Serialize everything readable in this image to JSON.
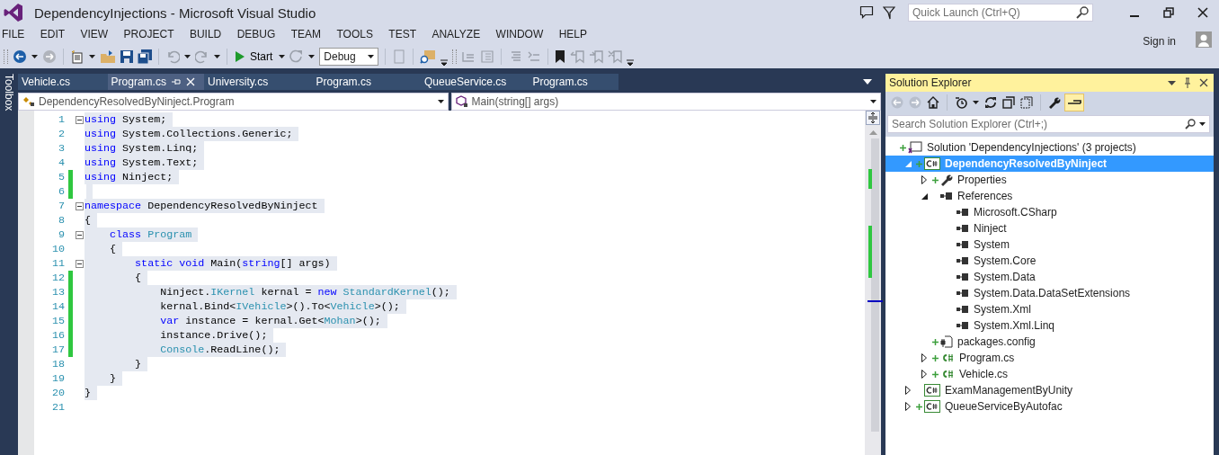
{
  "window": {
    "title": "DependencyInjections - Microsoft Visual Studio"
  },
  "quick_launch": {
    "placeholder": "Quick Launch (Ctrl+Q)"
  },
  "account": {
    "label": "Sign in"
  },
  "menu": [
    "FILE",
    "EDIT",
    "VIEW",
    "PROJECT",
    "BUILD",
    "DEBUG",
    "TEAM",
    "TOOLS",
    "TEST",
    "ANALYZE",
    "WINDOW",
    "HELP"
  ],
  "toolbar": {
    "start": "Start",
    "configuration": "Debug"
  },
  "toolbox": {
    "label": "Toolbox"
  },
  "tabs": [
    {
      "label": "Vehicle.cs",
      "selected": false
    },
    {
      "label": "Program.cs",
      "selected": true
    },
    {
      "label": "University.cs",
      "selected": false
    },
    {
      "label": "Program.cs",
      "selected": false
    },
    {
      "label": "QueueService.cs",
      "selected": false
    },
    {
      "label": "Program.cs",
      "selected": false
    }
  ],
  "navigation": {
    "type": "DependencyResolvedByNinject.Program",
    "member": "Main(string[] args)"
  },
  "code_lines": [
    {
      "number": "1",
      "foldable": true,
      "changed": false,
      "selected": true,
      "tokens": [
        {
          "kind": "kw",
          "text": "using"
        },
        {
          "kind": "plain",
          "text": " System;"
        }
      ]
    },
    {
      "number": "2",
      "foldable": false,
      "changed": false,
      "selected": true,
      "tokens": [
        {
          "kind": "kw",
          "text": "using"
        },
        {
          "kind": "plain",
          "text": " System.Collections.Generic;"
        }
      ]
    },
    {
      "number": "3",
      "foldable": false,
      "changed": false,
      "selected": true,
      "tokens": [
        {
          "kind": "kw",
          "text": "using"
        },
        {
          "kind": "plain",
          "text": " System.Linq;"
        }
      ]
    },
    {
      "number": "4",
      "foldable": false,
      "changed": false,
      "selected": true,
      "tokens": [
        {
          "kind": "kw",
          "text": "using"
        },
        {
          "kind": "plain",
          "text": " System.Text;"
        }
      ]
    },
    {
      "number": "5",
      "foldable": false,
      "changed": true,
      "selected": true,
      "tokens": [
        {
          "kind": "kw",
          "text": "using"
        },
        {
          "kind": "plain",
          "text": " Ninject;"
        }
      ]
    },
    {
      "number": "6",
      "foldable": false,
      "changed": true,
      "selected": true
    },
    {
      "number": "7",
      "foldable": true,
      "changed": false,
      "selected": true,
      "tokens": [
        {
          "kind": "kw",
          "text": "namespace"
        },
        {
          "kind": "plain",
          "text": " DependencyResolvedByNinject"
        }
      ]
    },
    {
      "number": "8",
      "foldable": false,
      "changed": false,
      "selected": true,
      "tokens": [
        {
          "kind": "plain",
          "text": "{"
        }
      ]
    },
    {
      "number": "9",
      "foldable": true,
      "changed": false,
      "selected": true,
      "tokens": [
        {
          "kind": "kw",
          "text": "    class "
        },
        {
          "kind": "type",
          "text": "Program"
        }
      ]
    },
    {
      "number": "10",
      "foldable": false,
      "changed": false,
      "selected": true,
      "tokens": [
        {
          "kind": "plain",
          "text": "    {"
        }
      ]
    },
    {
      "number": "11",
      "foldable": true,
      "changed": false,
      "selected": true,
      "tokens": [
        {
          "kind": "kw",
          "text": "        static void"
        },
        {
          "kind": "plain",
          "text": " Main("
        },
        {
          "kind": "kw",
          "text": "string"
        },
        {
          "kind": "plain",
          "text": "[] args)"
        }
      ]
    },
    {
      "number": "12",
      "foldable": false,
      "changed": true,
      "selected": true,
      "tokens": [
        {
          "kind": "plain",
          "text": "        {"
        }
      ]
    },
    {
      "number": "13",
      "foldable": false,
      "changed": true,
      "selected": true,
      "tokens": [
        {
          "kind": "plain",
          "text": "            Ninject."
        },
        {
          "kind": "type",
          "text": "IKernel"
        },
        {
          "kind": "plain",
          "text": " kernal = "
        },
        {
          "kind": "kw",
          "text": "new "
        },
        {
          "kind": "type",
          "text": "StandardKernel"
        },
        {
          "kind": "plain",
          "text": "();"
        }
      ]
    },
    {
      "number": "14",
      "foldable": false,
      "changed": true,
      "selected": true,
      "tokens": [
        {
          "kind": "plain",
          "text": "            kernal.Bind<"
        },
        {
          "kind": "type",
          "text": "IVehicle"
        },
        {
          "kind": "plain",
          "text": ">().To<"
        },
        {
          "kind": "type",
          "text": "Vehicle"
        },
        {
          "kind": "plain",
          "text": ">();"
        }
      ]
    },
    {
      "number": "15",
      "foldable": false,
      "changed": true,
      "selected": true,
      "tokens": [
        {
          "kind": "kw",
          "text": "            var"
        },
        {
          "kind": "plain",
          "text": " instance = kernal.Get<"
        },
        {
          "kind": "type",
          "text": "Mohan"
        },
        {
          "kind": "plain",
          "text": ">();"
        }
      ]
    },
    {
      "number": "16",
      "foldable": false,
      "changed": true,
      "selected": true,
      "tokens": [
        {
          "kind": "plain",
          "text": "            instance.Drive();"
        }
      ]
    },
    {
      "number": "17",
      "foldable": false,
      "changed": true,
      "selected": true,
      "tokens": [
        {
          "kind": "type",
          "text": "            Console"
        },
        {
          "kind": "plain",
          "text": ".ReadLine();"
        }
      ]
    },
    {
      "number": "18",
      "foldable": false,
      "changed": false,
      "selected": true,
      "tokens": [
        {
          "kind": "plain",
          "text": "        }"
        }
      ]
    },
    {
      "number": "19",
      "foldable": false,
      "changed": false,
      "selected": true,
      "tokens": [
        {
          "kind": "plain",
          "text": "    }"
        }
      ]
    },
    {
      "number": "20",
      "foldable": false,
      "changed": false,
      "selected": true,
      "tokens": [
        {
          "kind": "plain",
          "text": "}"
        }
      ]
    },
    {
      "number": "21",
      "foldable": false,
      "changed": false,
      "selected": false
    }
  ],
  "solution_explorer": {
    "title": "Solution Explorer",
    "search": {
      "placeholder": "Search Solution Explorer (Ctrl+;)"
    },
    "tree": [
      {
        "label": "Solution 'DependencyInjections' (3 projects)",
        "kind": "solution",
        "added": true,
        "selected": false,
        "children": [
          {
            "label": "DependencyResolvedByNinject",
            "kind": "project",
            "added": true,
            "selected": true,
            "expanded": true,
            "children": [
              {
                "label": "Properties",
                "kind": "properties",
                "added": true,
                "selected": false,
                "expanded": false
              },
              {
                "label": "References",
                "kind": "references",
                "added": false,
                "selected": false,
                "expanded": true,
                "children": [
                  {
                    "label": "Microsoft.CSharp",
                    "kind": "reference",
                    "added": false,
                    "selected": false
                  },
                  {
                    "label": "Ninject",
                    "kind": "reference",
                    "added": false,
                    "selected": false
                  },
                  {
                    "label": "System",
                    "kind": "reference",
                    "added": false,
                    "selected": false
                  },
                  {
                    "label": "System.Core",
                    "kind": "reference",
                    "added": false,
                    "selected": false
                  },
                  {
                    "label": "System.Data",
                    "kind": "reference",
                    "added": false,
                    "selected": false
                  },
                  {
                    "label": "System.Data.DataSetExtensions",
                    "kind": "reference",
                    "added": false,
                    "selected": false
                  },
                  {
                    "label": "System.Xml",
                    "kind": "reference",
                    "added": false,
                    "selected": false
                  },
                  {
                    "label": "System.Xml.Linq",
                    "kind": "reference",
                    "added": false,
                    "selected": false
                  }
                ]
              },
              {
                "label": "packages.config",
                "kind": "config",
                "added": true,
                "selected": false
              },
              {
                "label": "Program.cs",
                "kind": "csfile",
                "added": true,
                "selected": false,
                "expanded": false
              },
              {
                "label": "Vehicle.cs",
                "kind": "csfile",
                "added": true,
                "selected": false,
                "expanded": false
              }
            ]
          },
          {
            "label": "ExamManagementByUnity",
            "kind": "project",
            "added": false,
            "selected": false,
            "expanded": false
          },
          {
            "label": "QueueServiceByAutofac",
            "kind": "project",
            "added": true,
            "selected": false,
            "expanded": false
          }
        ]
      }
    ]
  }
}
